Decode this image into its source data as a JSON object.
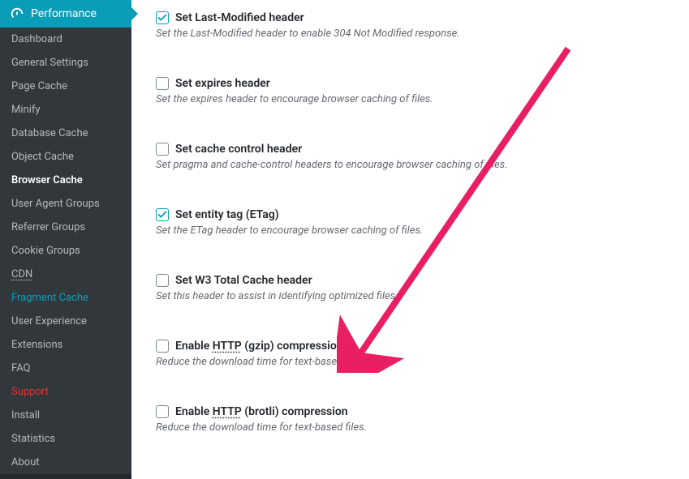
{
  "sidebar": {
    "header": "Performance",
    "items": [
      {
        "label": "Dashboard",
        "active": false
      },
      {
        "label": "General Settings",
        "active": false
      },
      {
        "label": "Page Cache",
        "active": false
      },
      {
        "label": "Minify",
        "active": false
      },
      {
        "label": "Database Cache",
        "active": false
      },
      {
        "label": "Object Cache",
        "active": false
      },
      {
        "label": "Browser Cache",
        "active": true
      },
      {
        "label": "User Agent Groups",
        "active": false
      },
      {
        "label": "Referrer Groups",
        "active": false
      },
      {
        "label": "Cookie Groups",
        "active": false
      },
      {
        "label": "CDN",
        "active": false,
        "dotted": true
      },
      {
        "label": "Fragment Cache",
        "active": false,
        "color": "teal"
      },
      {
        "label": "User Experience",
        "active": false
      },
      {
        "label": "Extensions",
        "active": false
      },
      {
        "label": "FAQ",
        "active": false
      },
      {
        "label": "Support",
        "active": false,
        "color": "red"
      },
      {
        "label": "Install",
        "active": false
      },
      {
        "label": "Statistics",
        "active": false
      },
      {
        "label": "About",
        "active": false
      }
    ]
  },
  "options": [
    {
      "label_pre": "Set Last-Modified header",
      "label_dotted": "",
      "label_post": "",
      "desc": "Set the Last-Modified header to enable 304 Not Modified response.",
      "checked": true
    },
    {
      "label_pre": "Set expires header",
      "label_dotted": "",
      "label_post": "",
      "desc": "Set the expires header to encourage browser caching of files.",
      "checked": false
    },
    {
      "label_pre": "Set cache control header",
      "label_dotted": "",
      "label_post": "",
      "desc": "Set pragma and cache-control headers to encourage browser caching of files.",
      "checked": false
    },
    {
      "label_pre": "Set entity tag (ETag)",
      "label_dotted": "",
      "label_post": "",
      "desc": "Set the ETag header to encourage browser caching of files.",
      "checked": true
    },
    {
      "label_pre": "Set W3 Total Cache header",
      "label_dotted": "",
      "label_post": "",
      "desc": "Set this header to assist in identifying optimized files.",
      "checked": false
    },
    {
      "label_pre": "Enable ",
      "label_dotted": "HTTP",
      "label_post": " (gzip) compression",
      "desc": "Reduce the download time for text-based files.",
      "checked": false
    },
    {
      "label_pre": "Enable ",
      "label_dotted": "HTTP",
      "label_post": " (brotli) compression",
      "desc": "Reduce the download time for text-based files.",
      "checked": false
    }
  ],
  "colors": {
    "accent": "#0a9db8",
    "arrow": "#e91e63"
  }
}
